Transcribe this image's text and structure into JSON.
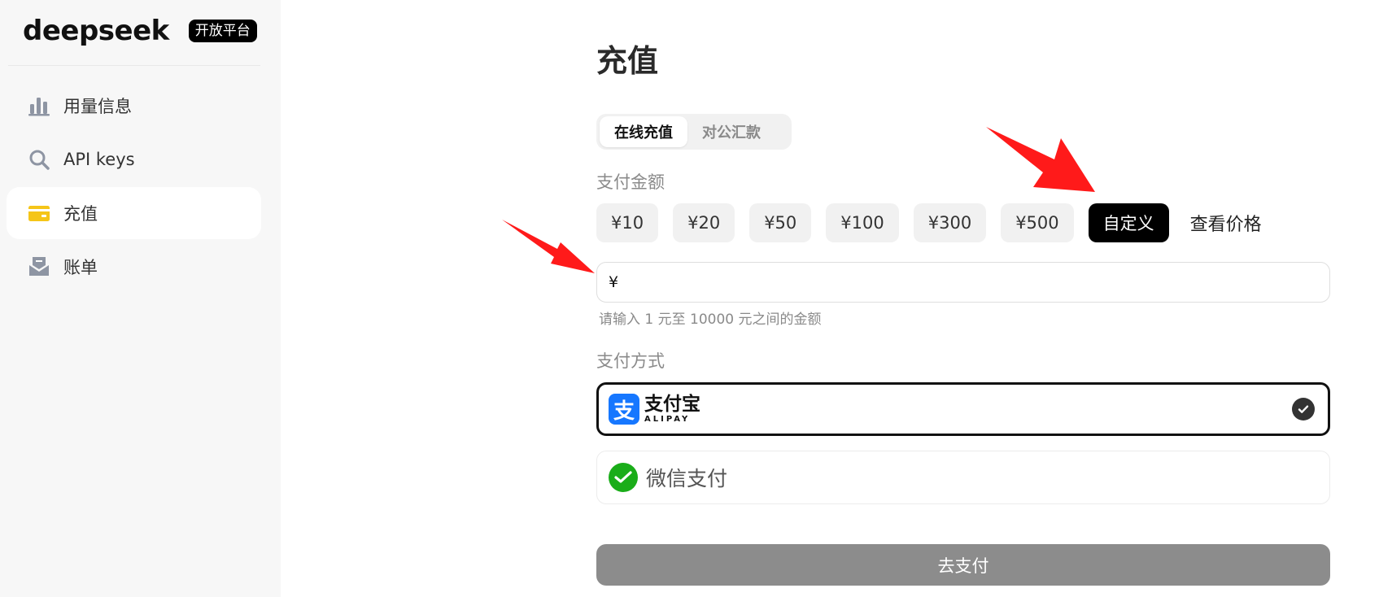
{
  "app": {
    "logo_text": "deepseek",
    "platform_badge": "开放平台"
  },
  "sidebar": {
    "items": [
      {
        "label": "用量信息",
        "icon": "bar-chart-icon"
      },
      {
        "label": "API keys",
        "icon": "search-icon"
      },
      {
        "label": "充值",
        "icon": "wallet-icon",
        "active": true
      },
      {
        "label": "账单",
        "icon": "inbox-icon"
      }
    ]
  },
  "main": {
    "title": "充值",
    "tabs": [
      {
        "label": "在线充值",
        "active": true
      },
      {
        "label": "对公汇款",
        "active": false
      }
    ],
    "amount_section_label": "支付金额",
    "amount_options": [
      {
        "label": "¥10"
      },
      {
        "label": "¥20"
      },
      {
        "label": "¥50"
      },
      {
        "label": "¥100"
      },
      {
        "label": "¥300"
      },
      {
        "label": "¥500"
      },
      {
        "label": "自定义",
        "selected": true
      }
    ],
    "view_price_label": "查看价格",
    "amount_input": {
      "prefix": "¥",
      "value": "",
      "hint": "请输入 1 元至 10000 元之间的金额"
    },
    "payment_section_label": "支付方式",
    "payment_methods": {
      "alipay": {
        "cn": "支付宝",
        "en": "ALIPAY",
        "logo_glyph": "支",
        "selected": true
      },
      "wechat": {
        "label": "微信支付",
        "selected": false
      }
    },
    "pay_button_label": "去支付"
  },
  "colors": {
    "alipay_blue": "#1677ff",
    "wechat_green": "#1aad19",
    "wallet_yellow": "#f5c518",
    "annotation_red": "#ff1a1a",
    "disabled_button": "#8c8c8c"
  }
}
